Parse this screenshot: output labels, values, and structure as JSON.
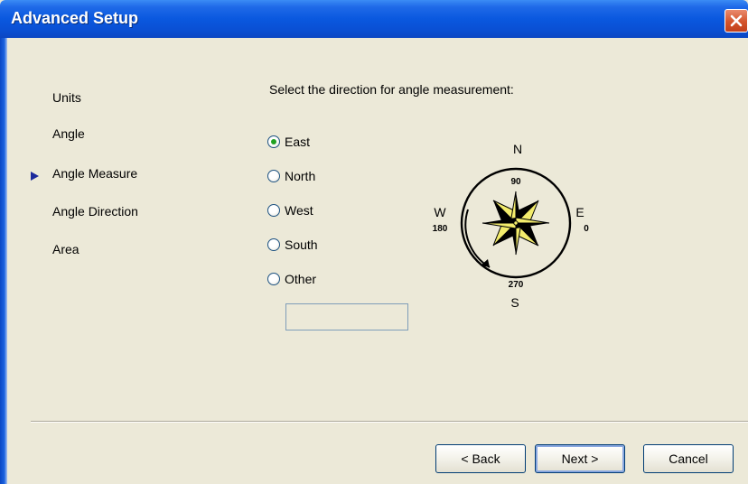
{
  "window": {
    "title": "Advanced Setup"
  },
  "nav": {
    "items": [
      {
        "label": "Units"
      },
      {
        "label": "Angle"
      },
      {
        "label": "Angle Measure",
        "current": true
      },
      {
        "label": "Angle Direction"
      },
      {
        "label": "Area"
      }
    ]
  },
  "main": {
    "prompt": "Select the direction for angle measurement:",
    "options": [
      {
        "label": "East",
        "selected": true
      },
      {
        "label": "North",
        "selected": false
      },
      {
        "label": "West",
        "selected": false
      },
      {
        "label": "South",
        "selected": false
      },
      {
        "label": "Other",
        "selected": false
      }
    ],
    "other_value": ""
  },
  "compass": {
    "north": "N",
    "south": "S",
    "east": "E",
    "west": "W",
    "deg_north": "90",
    "deg_east": "0",
    "deg_west": "180",
    "deg_south": "270"
  },
  "buttons": {
    "back": "< Back",
    "next": "Next >",
    "cancel": "Cancel"
  },
  "colors": {
    "titlebar": "#0a58df",
    "dialog_bg": "#ece9d8",
    "radio_dot": "#21a121",
    "star_fill": "#f3ec6c",
    "nav_arrow": "#1c2a9c"
  }
}
